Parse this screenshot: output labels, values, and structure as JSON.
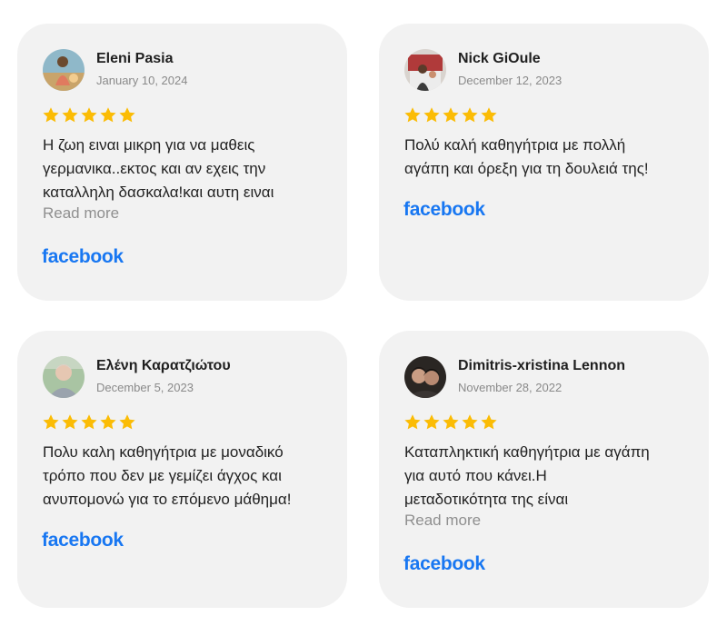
{
  "colors": {
    "card_background": "#f2f2f2",
    "star": "#fbbc05",
    "facebook_blue": "#1877f2",
    "read_more": "#8f8f8f",
    "date": "#8a8a8a"
  },
  "reviews": [
    {
      "name": "Eleni Pasia",
      "date": "January 10, 2024",
      "rating": 5,
      "text_lines": [
        "Η ζωη ειναι μικρη για να μαθεις",
        "γερμανικα..εκτος και αν εχεις την",
        "καταλληλη δασκαλα!και αυτη ειναι"
      ],
      "read_more": "Read more",
      "source": "facebook"
    },
    {
      "name": "Nick GiOule",
      "date": "December 12, 2023",
      "rating": 5,
      "text_lines": [
        "Πολύ καλή καθηγήτρια με πολλή",
        "αγάπη και όρεξη για τη δουλειά της!"
      ],
      "source": "facebook"
    },
    {
      "name": "Ελένη Καρατζιώτου",
      "date": "December 5, 2023",
      "rating": 5,
      "text_lines": [
        "Πολυ καλη καθηγήτρια με μοναδικό",
        "τρόπο που δεν με γεμίζει άγχος και",
        "ανυπομονώ για το επόμενο μάθημα!"
      ],
      "source": "facebook"
    },
    {
      "name": "Dimitris-xristina Lennon",
      "date": "November 28, 2022",
      "rating": 5,
      "text_lines": [
        "Καταπληκτική καθηγήτρια με αγάπη",
        "για αυτό που κάνει.Η",
        "μεταδοτικότητα της είναι"
      ],
      "read_more": "Read more",
      "source": "facebook"
    }
  ]
}
